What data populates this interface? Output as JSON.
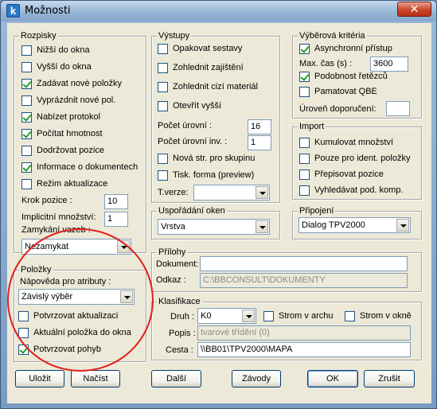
{
  "window": {
    "title": "Možnosti",
    "app_icon_letter": "k",
    "close_glyph": "✕"
  },
  "rozpisky": {
    "title": "Rozpisky",
    "items": [
      {
        "label": "Nižší do okna",
        "checked": false
      },
      {
        "label": "Vyšší do okna",
        "checked": false
      },
      {
        "label": "Zadávat nové položky",
        "checked": true
      },
      {
        "label": "Vyprázdnit nové pol.",
        "checked": false
      },
      {
        "label": "Nabízet protokol",
        "checked": true
      },
      {
        "label": "Počítat hmotnost",
        "checked": true
      },
      {
        "label": "Dodržovat pozice",
        "checked": false
      },
      {
        "label": "Informace o dokumentech",
        "checked": true
      },
      {
        "label": "Režim aktualizace",
        "checked": false
      }
    ],
    "krok_label": "Krok pozice :",
    "krok_value": "10",
    "implicitni_label": "Implicitní množství:",
    "implicitni_value": "1",
    "zamykani_label": "Zamykání vazeb :",
    "zamykani_value": "Nezamykat"
  },
  "polozky": {
    "title": "Položky",
    "napoveda_label": "Nápověda pro atributy :",
    "napoveda_value": "Závislý výběr",
    "items": [
      {
        "label": "Potvrzovat aktualizaci",
        "checked": false
      },
      {
        "label": "Aktuální položka do okna",
        "checked": false
      },
      {
        "label": "Potvrzovat pohyb",
        "checked": true
      }
    ]
  },
  "vystupy": {
    "title": "Výstupy",
    "items": [
      {
        "label": "Opakovat sestavy",
        "checked": false
      },
      {
        "label": "Zohlednit zajištění",
        "checked": false
      },
      {
        "label": "Zohlednit cizí materiál",
        "checked": false
      },
      {
        "label": "Otevřít vyšší",
        "checked": false
      }
    ],
    "pocet_urovni_label": "Počet úrovní :",
    "pocet_urovni_value": "16",
    "pocet_urovni_inv_label": "Počet úrovní inv. :",
    "pocet_urovni_inv_value": "1",
    "items2": [
      {
        "label": "Nová str. pro skupinu",
        "checked": false
      },
      {
        "label": "Tisk. forma (preview)",
        "checked": false
      }
    ],
    "tverze_label": "T.verze:",
    "tverze_value": ""
  },
  "usporadani": {
    "title": "Uspořádání oken",
    "value": "Vrstva"
  },
  "vyberova": {
    "title": "Výběrová kritéria",
    "asynchronni": {
      "label": "Asynchronní přístup",
      "checked": true
    },
    "max_cas_label": "Max. čas (s) :",
    "max_cas_value": "3600",
    "podobnost": {
      "label": "Podobnost řetězců",
      "checked": true
    },
    "pamatovat": {
      "label": "Pamatovat QBE",
      "checked": false
    },
    "uroven_label": "Úroveň doporučení:",
    "uroven_value": ""
  },
  "import": {
    "title": "Import",
    "items": [
      {
        "label": "Kumulovat množství",
        "checked": false
      },
      {
        "label": "Pouze pro ident. položky",
        "checked": false
      },
      {
        "label": "Přepisovat pozice",
        "checked": false
      },
      {
        "label": "Vyhledávat pod. komp.",
        "checked": false
      }
    ]
  },
  "pripojeni": {
    "title": "Připojení",
    "value": "Dialog TPV2000"
  },
  "prilohy": {
    "title": "Přílohy",
    "dokument_label": "Dokument:",
    "dokument_value": "",
    "odkaz_label": "Odkaz :",
    "odkaz_value": "C:\\BBCONSULT\\DOKUMENTY"
  },
  "klasifikace": {
    "title": "Klasifikace",
    "druh_label": "Druh :",
    "druh_value": "K0",
    "strom_archu": {
      "label": "Strom v archu",
      "checked": false
    },
    "strom_okne": {
      "label": "Strom v okně",
      "checked": false
    },
    "popis_label": "Popis :",
    "popis_value": "tvarové třídění (0)",
    "cesta_label": "Cesta :",
    "cesta_value": "\\\\BB01\\TPV2000\\MAPA"
  },
  "buttons": {
    "ulozit": "Uložit",
    "nacist": "Načíst",
    "dalsi": "Další",
    "zavody": "Závody",
    "ok": "OK",
    "zrusit": "Zrušit"
  },
  "colors": {
    "annotation_circle": "#e0201c",
    "check_mark": "#21a121"
  }
}
